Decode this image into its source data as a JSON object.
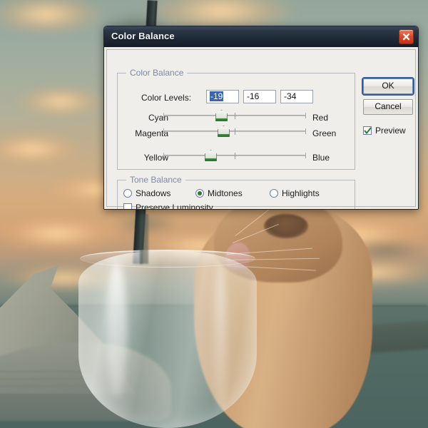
{
  "window": {
    "title": "Color Balance",
    "close_icon": "close-x-icon"
  },
  "color_balance_group": {
    "legend": "Color Balance",
    "color_levels_label": "Color Levels:",
    "fields": [
      {
        "name": "shadows-red-level",
        "value": "-19",
        "selected": true
      },
      {
        "name": "magenta-green-level",
        "value": "-16",
        "selected": false
      },
      {
        "name": "yellow-blue-level",
        "value": "-34",
        "selected": false
      }
    ],
    "sliders": [
      {
        "left_label": "Cyan",
        "right_label": "Red",
        "value": -19,
        "min": -100,
        "max": 100
      },
      {
        "left_label": "Magenta",
        "right_label": "Green",
        "value": -16,
        "min": -100,
        "max": 100
      },
      {
        "left_label": "Yellow",
        "right_label": "Blue",
        "value": -34,
        "min": -100,
        "max": 100
      }
    ]
  },
  "tone_balance_group": {
    "legend": "Tone Balance",
    "options": [
      {
        "label": "Shadows",
        "selected": false
      },
      {
        "label": "Midtones",
        "selected": true
      },
      {
        "label": "Highlights",
        "selected": false
      }
    ],
    "preserve_luminosity": {
      "label": "Preserve Luminosity",
      "checked": false
    }
  },
  "buttons": {
    "ok": "OK",
    "cancel": "Cancel"
  },
  "preview": {
    "label": "Preview",
    "checked": true
  },
  "colors": {
    "titlebar": "#1f2936",
    "close_button": "#e04a28",
    "group_legend": "#7b89a8",
    "selection_highlight": "#3a64b0",
    "slider_accent": "#2d7d2d",
    "default_button_outline": "#2f5fa8",
    "dialog_face": "#efeeea"
  }
}
